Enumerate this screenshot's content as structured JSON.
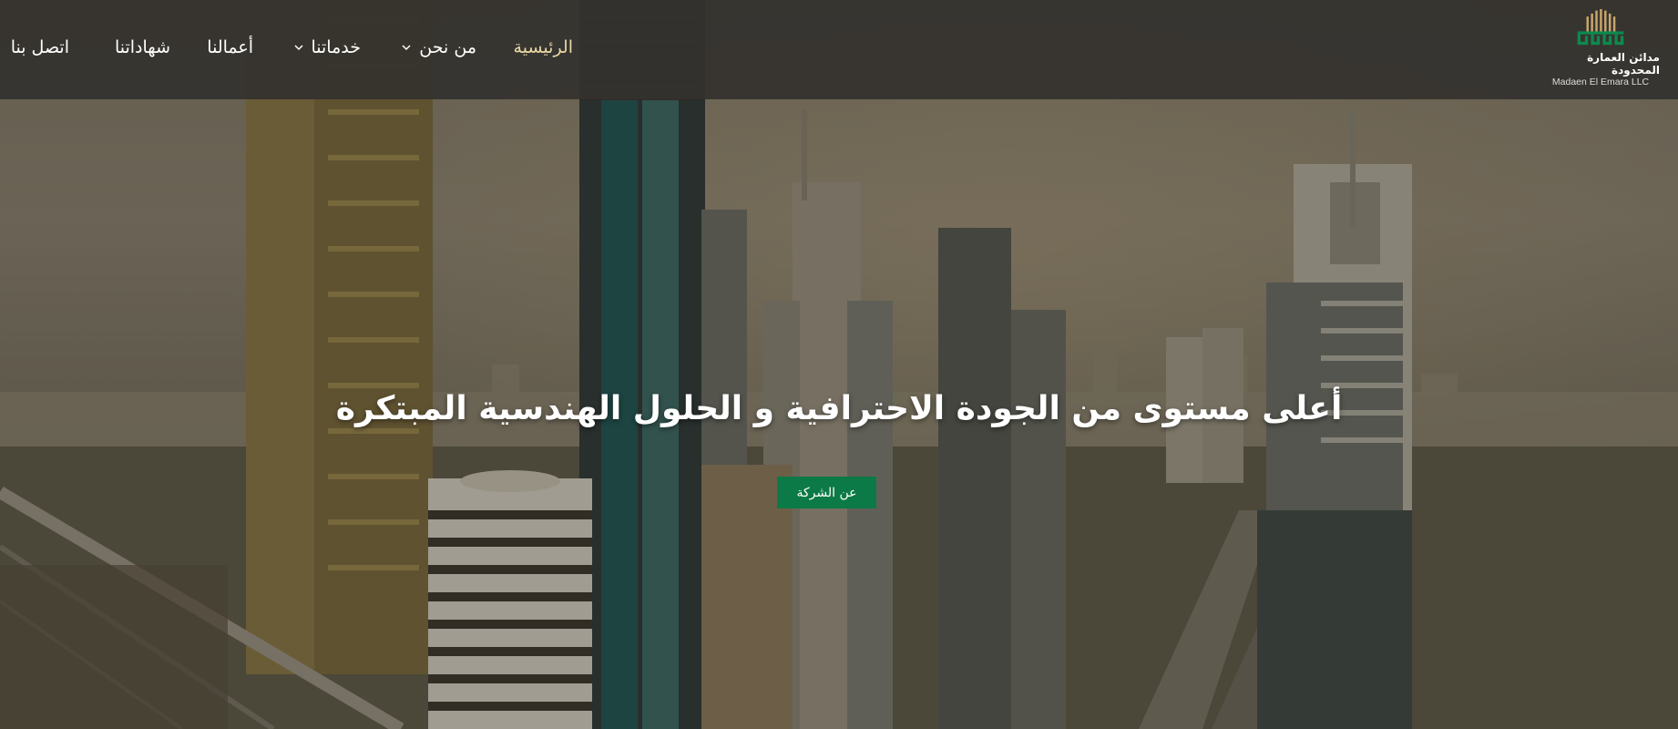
{
  "brand": {
    "name_ar": "مدائن العمارة المحدودة",
    "name_en": "Madaen El Emara LLC",
    "logo_icon": "building-logo-icon",
    "accent_green": "#0c7a46",
    "accent_gold": "#c9a66b"
  },
  "nav": {
    "items": [
      {
        "label": "الرئيسية",
        "active": true,
        "has_dropdown": false
      },
      {
        "label": "من نحن",
        "active": false,
        "has_dropdown": true
      },
      {
        "label": "خدماتنا",
        "active": false,
        "has_dropdown": true
      },
      {
        "label": "أعمالنا",
        "active": false,
        "has_dropdown": false
      },
      {
        "label": "شهاداتنا",
        "active": false,
        "has_dropdown": false
      },
      {
        "label": "اتصل بنا",
        "active": false,
        "has_dropdown": false
      }
    ],
    "dropdown_icon": "chevron-down-icon"
  },
  "hero": {
    "headline": "أعلى مستوى من الجودة الاحترافية و الحلول الهندسية المبتكرة",
    "cta_label": "عن الشركة",
    "background": "city-skyline-photo"
  }
}
